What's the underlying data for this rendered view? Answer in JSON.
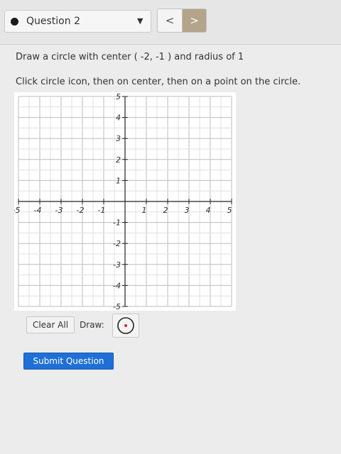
{
  "header": {
    "question_label": "Question 2",
    "prev_label": "<",
    "next_label": ">"
  },
  "instructions": {
    "line1": "Draw a circle with center ( -2, -1 ) and radius of 1",
    "line2": "Click circle icon, then on center, then on a point on the circle."
  },
  "graph": {
    "x_range": [
      -5,
      5
    ],
    "y_range": [
      -5,
      5
    ],
    "grid": true,
    "minor_step": 0.5,
    "x_tick_labels": [
      "-5",
      "-4",
      "-3",
      "-2",
      "-1",
      "1",
      "2",
      "3",
      "4",
      "5"
    ],
    "y_tick_labels": [
      "5",
      "4",
      "3",
      "2",
      "1",
      "-1",
      "-2",
      "-3",
      "-4",
      "-5"
    ]
  },
  "toolbar": {
    "clear_label": "Clear All",
    "draw_label": "Draw:",
    "circle_tool_icon": "circle-icon"
  },
  "submit_label": "Submit Question",
  "colors": {
    "submit": "#1f6fd6",
    "next_button": "#b4a48c",
    "circle_tool_dot": "#d9262a"
  }
}
